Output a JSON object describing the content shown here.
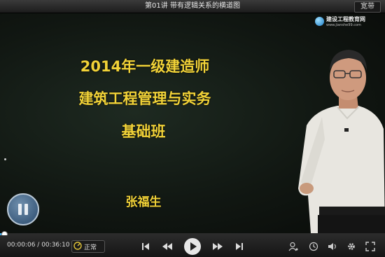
{
  "titlebar": {
    "title": "第01讲   带有逻辑关系的横道图",
    "bandwidth_button": "宽带"
  },
  "video": {
    "logo": {
      "name": "建设工程教育网",
      "url": "www.jianshe99.com"
    },
    "slide": {
      "line1": "2014年一级建造师",
      "line2": "建筑工程管理与实务",
      "line3": "基础班",
      "lecturer": "张福生"
    },
    "state": "paused",
    "progress_fraction": 0.0028
  },
  "controls": {
    "current_time": "00:00:06",
    "total_time": "00:36:10",
    "speed_label": "正常",
    "icons": [
      "prev-icon",
      "rewind-icon",
      "play-icon",
      "forward-icon",
      "next-icon",
      "user-icon",
      "clock-icon",
      "volume-icon",
      "settings-icon",
      "fullscreen-icon"
    ],
    "accent": "#3aa3e3",
    "slide_text_color": "#f2d338"
  }
}
